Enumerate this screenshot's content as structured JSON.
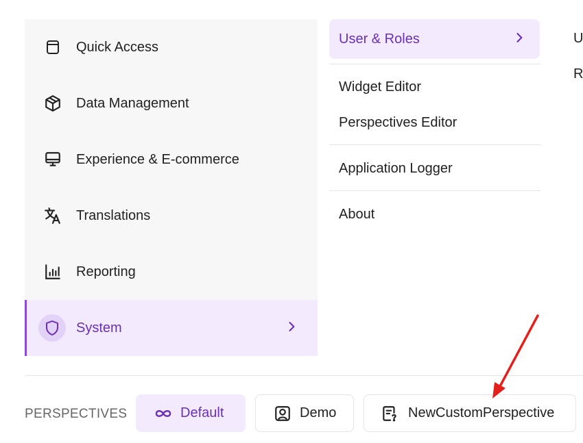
{
  "main_menu": {
    "items": [
      {
        "label": "Quick Access",
        "icon": "window-icon"
      },
      {
        "label": "Data Management",
        "icon": "cube-icon"
      },
      {
        "label": "Experience & E-commerce",
        "icon": "monitor-icon"
      },
      {
        "label": "Translations",
        "icon": "translate-icon"
      },
      {
        "label": "Reporting",
        "icon": "bar-chart-icon"
      },
      {
        "label": "System",
        "icon": "shield-icon",
        "active": true
      }
    ]
  },
  "submenu": {
    "active_label": "User & Roles",
    "items": [
      "Widget Editor",
      "Perspectives Editor",
      "Application Logger",
      "About"
    ]
  },
  "third_column": {
    "items": [
      "U",
      "Ro"
    ]
  },
  "perspectives": {
    "section_label": "PERSPECTIVES",
    "options": [
      {
        "label": "Default",
        "icon": "infinity-icon",
        "active": true
      },
      {
        "label": "Demo",
        "icon": "user-portrait-icon"
      },
      {
        "label": "NewCustomPerspective",
        "icon": "document-question-icon"
      }
    ]
  },
  "colors": {
    "accent": "#6a2fb3",
    "active_bg": "#f3ebfd",
    "menu_bg": "#f7f7f7",
    "annotation_arrow": "#e3201b"
  }
}
